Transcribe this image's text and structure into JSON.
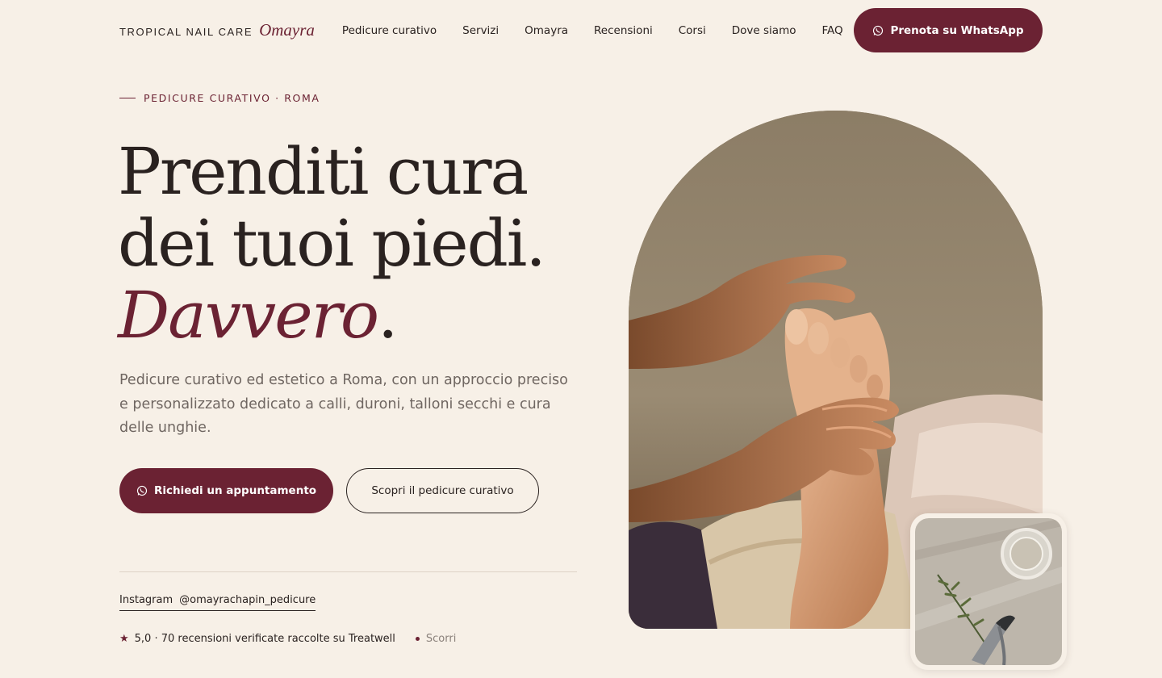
{
  "brand": {
    "name": "TROPICAL NAIL CARE",
    "script": "Omayra"
  },
  "nav": {
    "links": [
      "Pedicure curativo",
      "Servizi",
      "Omayra",
      "Recensioni",
      "Corsi",
      "Dove siamo",
      "FAQ"
    ],
    "cta_label": "Prenota su WhatsApp"
  },
  "hero": {
    "eyebrow": "PEDICURE CURATIVO · ROMA",
    "headline_line1": "Prenditi cura",
    "headline_line2": "dei tuoi piedi.",
    "headline_accent": "Davvero",
    "headline_period": ".",
    "lead": "Pedicure curativo ed estetico a Roma, con un approccio preciso e personalizzato dedicato a calli, duroni, talloni secchi e cura delle unghie.",
    "primary_cta": "Richiedi un appuntamento",
    "secondary_cta": "Scopri il pedicure curativo",
    "instagram_label": "Instagram",
    "instagram_handle": "@omayrachapin_pedicure",
    "rating_text": "5,0 · 70 recensioni verificate raccolte su Treatwell",
    "scroll_label": "Scorri"
  },
  "icons": {
    "whatsapp": "whatsapp-icon",
    "star": "star-icon",
    "dot": "dot-icon"
  },
  "colors": {
    "background": "#f7f0e7",
    "accent": "#6b2233",
    "text": "#2a2220",
    "muted": "#6f6661"
  }
}
